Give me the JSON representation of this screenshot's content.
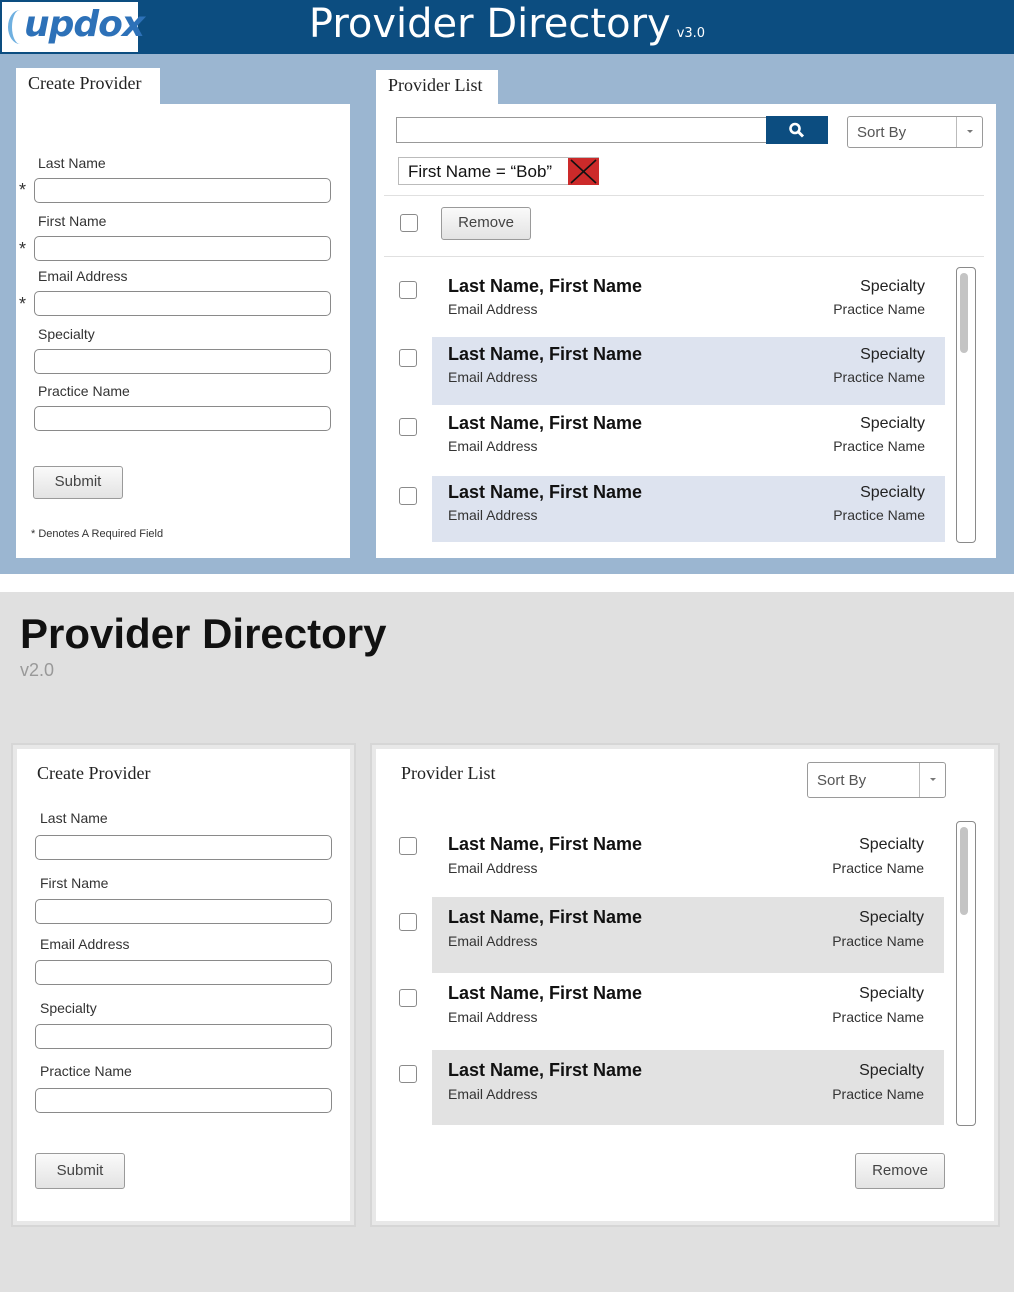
{
  "v3": {
    "logo": "updox",
    "title": "Provider Directory",
    "version": "v3.0",
    "create": {
      "tab": "Create Provider",
      "fields": [
        {
          "label": "Last Name",
          "required": true
        },
        {
          "label": "First Name",
          "required": true
        },
        {
          "label": "Email Address",
          "required": true
        },
        {
          "label": "Specialty",
          "required": false
        },
        {
          "label": "Practice Name",
          "required": false
        }
      ],
      "required_marker": "*",
      "submit": "Submit",
      "footnote": "* Denotes A Required Field"
    },
    "list": {
      "tab": "Provider List",
      "search_value": "",
      "sort_label": "Sort By",
      "filter_chip": "First Name = “Bob”",
      "remove": "Remove",
      "rows": [
        {
          "name": "Last Name, First Name",
          "email": "Email Address",
          "specialty": "Specialty",
          "practice": "Practice Name",
          "highlighted": false
        },
        {
          "name": "Last Name, First Name",
          "email": "Email Address",
          "specialty": "Specialty",
          "practice": "Practice Name",
          "highlighted": true
        },
        {
          "name": "Last Name, First Name",
          "email": "Email Address",
          "specialty": "Specialty",
          "practice": "Practice Name",
          "highlighted": false
        },
        {
          "name": "Last Name, First Name",
          "email": "Email Address",
          "specialty": "Specialty",
          "practice": "Practice Name",
          "highlighted": true
        }
      ]
    },
    "colors": {
      "header": "#0c4d80",
      "background": "#9bb6d1",
      "highlight": "#dde3ef",
      "chip_close": "#cc2a2a"
    }
  },
  "v2": {
    "title": "Provider Directory",
    "version": "v2.0",
    "create": {
      "heading": "Create Provider",
      "fields": [
        "Last Name",
        "First Name",
        "Email Address",
        "Specialty",
        "Practice Name"
      ],
      "submit": "Submit"
    },
    "list": {
      "heading": "Provider List",
      "sort_label": "Sort By",
      "remove": "Remove",
      "rows": [
        {
          "name": "Last Name, First Name",
          "email": "Email Address",
          "specialty": "Specialty",
          "practice": "Practice Name",
          "highlighted": false
        },
        {
          "name": "Last Name, First Name",
          "email": "Email Address",
          "specialty": "Specialty",
          "practice": "Practice Name",
          "highlighted": true
        },
        {
          "name": "Last Name, First Name",
          "email": "Email Address",
          "specialty": "Specialty",
          "practice": "Practice Name",
          "highlighted": false
        },
        {
          "name": "Last Name, First Name",
          "email": "Email Address",
          "specialty": "Specialty",
          "practice": "Practice Name",
          "highlighted": true
        }
      ]
    },
    "colors": {
      "background": "#e0e0e0",
      "highlight": "#e2e2e2"
    }
  }
}
